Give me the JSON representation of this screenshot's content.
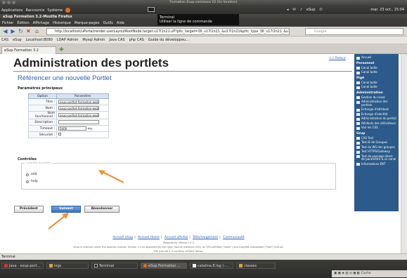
{
  "window": {
    "title": "Formation Esup-commons V2 (En fonction)"
  },
  "topbar": {
    "applications": "Applications",
    "raccourcis": "Raccourcis",
    "systeme": "Système",
    "clock": "mar. 23 oct., 15:04",
    "user": "eSup"
  },
  "tooltip": {
    "line1": "Terminal",
    "line2": "Utiliser la ligne de commande"
  },
  "firefox": {
    "title": "eSup Formation 3.2-Mozilla Firefox"
  },
  "menu": [
    "Fichier",
    "Édition",
    "Affichage",
    "Historique",
    "Marque-pages",
    "Outils",
    "Aide"
  ],
  "nav": {
    "url": "http://localhost/uPortal/render.userLayoutRootNode.target.u17l1n21.uP?pltc_target=36_u17l1n21_&u17l1n21&pltc_type_36_u17l1n21_&u17l1n21=REN",
    "search_placeholder": "Google"
  },
  "bookmarks": [
    "CAS",
    "eSup",
    "Localhost:8080",
    "LDAP Admin",
    "Mysql Admin",
    "Java CAS",
    "php CAS",
    "Guide du développeu..."
  ],
  "tab": {
    "label": "eSup Formation 3.2"
  },
  "page": {
    "title": "Administration des portlets",
    "retour": "<< Retour",
    "subtitle": "Référencer une nouvelle Portlet",
    "section1": "Paramètres principaux",
    "table": {
      "col_option": "Option",
      "col_param": "Paramètre",
      "rows": [
        {
          "label": "Titre :",
          "value": "esup-portlet-formation-web"
        },
        {
          "label": "Nom :",
          "value": "esup-portlet-formation-web"
        },
        {
          "label": "Nom fonctionnel :",
          "value": "esup-portlet-formation-web"
        },
        {
          "label": "Description :",
          "value": ""
        },
        {
          "label": "Timeout :",
          "value": "5000",
          "unit": "ms"
        },
        {
          "label": "Sécurisé :",
          "value": ""
        }
      ]
    },
    "section2": "Contrôles",
    "group_legend": "Contrôles du portlet",
    "options": [
      "edit",
      "help"
    ],
    "buttons": {
      "precedent": "Précédent",
      "suivant": "Suivant",
      "abandonner": "Abandonner"
    },
    "footer": {
      "links": [
        "Accueil eSup",
        "Accueil Home",
        "Accueil uPortal",
        "Téléchargement",
        "Communauté"
      ],
      "powered": "Powered by uPortal 2.5.3",
      "license": "eSup is licensed under the Apache License, Version 2.0 as approved by the Open Source Initiative (OSI), an OSI-certified (\"open\") and Copyleft-compatible (\"free\") license.",
      "icons": "Silk icon set 1.3 courtesy of Mark James."
    }
  },
  "sidebar": [
    {
      "title": "",
      "items": [
        "Accueil"
      ]
    },
    {
      "title": "Personnel",
      "items": [
        "Canal boîte",
        "Canal boîte"
      ]
    },
    {
      "title": "Pigé",
      "items": [
        "Canal boîte",
        "Canal boîte"
      ]
    },
    {
      "title": "Administration",
      "items": [
        "Gestion du canal",
        "Administration des portlets",
        "Echange d'attributs",
        "Echange d'identité",
        "Administration du portail",
        "Attributs des utilisateurs",
        "Voir les CSS"
      ]
    },
    {
      "title": "Grup",
      "items": [
        "CAS Test",
        "Test IE de Groupes",
        "Test du WS des groupes",
        "Test HTTPS/Gateway",
        "Test de passage direct de paramètre à un canal",
        "Informations ENT"
      ]
    }
  ],
  "status": {
    "text": "Terminé"
  },
  "taskbar": {
    "items": [
      "Java - esup-port...",
      "logs",
      "Terminal",
      "eSup Formation ...",
      "catalina.8.log (-...",
      "classes"
    ],
    "tray": "Cache"
  },
  "colors": {
    "accent": "#2f5fa5",
    "sidebar": "#2c5a8a",
    "arrow": "#f0923a"
  }
}
